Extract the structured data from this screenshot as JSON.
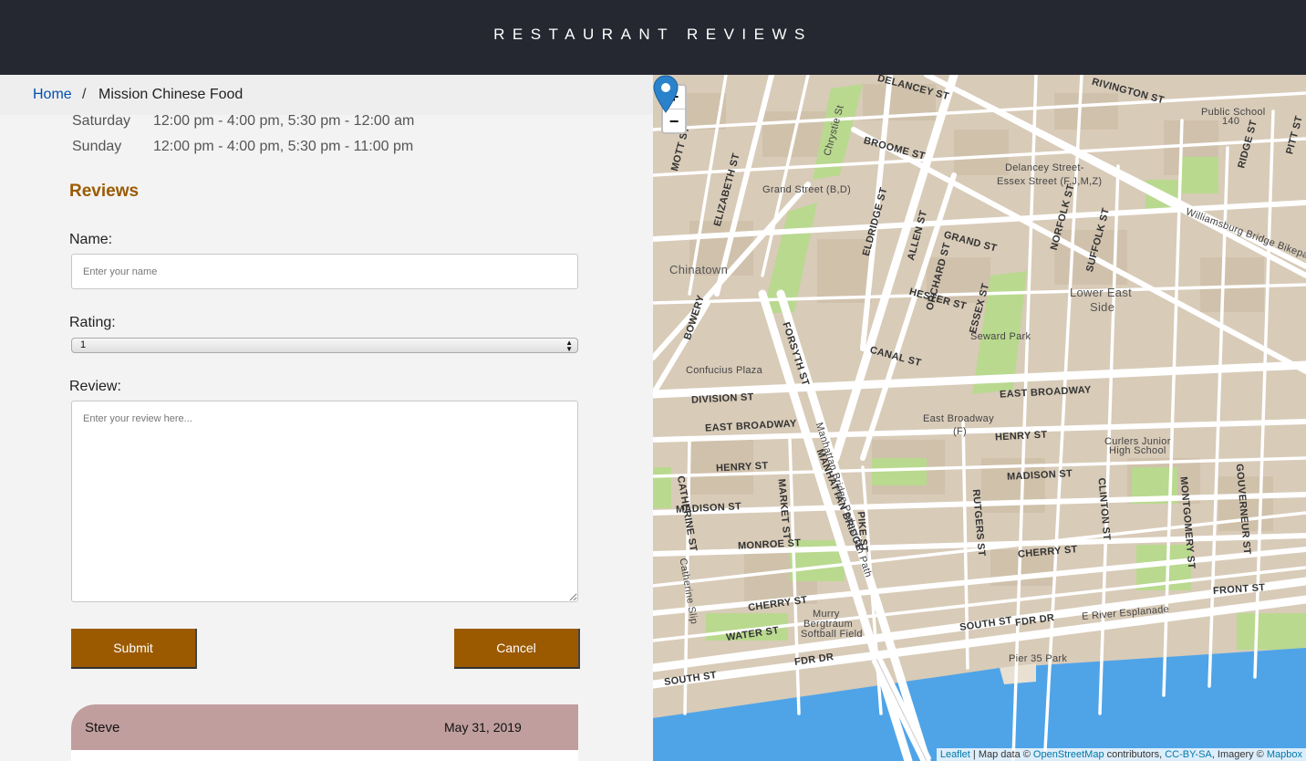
{
  "app": {
    "title": "RESTAURANT REVIEWS"
  },
  "breadcrumb": {
    "home": "Home",
    "separator": "/",
    "current": "Mission Chinese Food"
  },
  "hours": [
    {
      "day": "Saturday",
      "time": "12:00 pm - 4:00 pm, 5:30 pm - 12:00 am"
    },
    {
      "day": "Sunday",
      "time": "12:00 pm - 4:00 pm, 5:30 pm - 11:00 pm"
    }
  ],
  "reviews": {
    "title": "Reviews",
    "form": {
      "name_label": "Name:",
      "name_placeholder": "Enter your name",
      "name_value": "",
      "rating_label": "Rating:",
      "rating_value": "1",
      "review_label": "Review:",
      "review_placeholder": "Enter your review here...",
      "review_value": "",
      "submit_label": "Submit",
      "cancel_label": "Cancel"
    },
    "items": [
      {
        "name": "Steve",
        "date": "May 31, 2019"
      }
    ]
  },
  "map": {
    "zoom_in": "+",
    "zoom_out": "−",
    "labels": [
      "DELANCEY ST",
      "RIVINGTON ST",
      "BROOME ST",
      "Delancey Street-",
      "Essex Street (F,J,M,Z)",
      "Grand Street (B,D)",
      "GRAND ST",
      "Chinatown",
      "Lower East",
      "Side",
      "Seward Park",
      "CANAL ST",
      "Confucius Plaza",
      "DIVISION ST",
      "EAST BROADWAY",
      "East Broadway",
      "(F)",
      "HENRY ST",
      "Curlers Junior",
      "High School",
      "MADISON ST",
      "MONROE ST",
      "CHERRY ST",
      "WATER ST",
      "Murry",
      "Bergtraum",
      "Softball Field",
      "SOUTH ST",
      "FDR DR",
      "FRONT ST",
      "Pier 35 Park",
      "E River Esplanade",
      "Public School",
      "140",
      "BOWERY",
      "FORSYTH ST",
      "MANHATTAN BRIDGE",
      "PIKE ST",
      "RUTGERS ST",
      "CLINTON ST",
      "MONTGOMERY ST",
      "GOUVERNEUR ST",
      "ESSEX ST",
      "ORCHARD ST",
      "ALLEN ST",
      "ELDRIDGE ST",
      "NORFOLK ST",
      "SUFFOLK ST",
      "PITT ST",
      "RIDGE ST",
      "HESTER ST",
      "MOTT ST",
      "ELIZABETH ST",
      "Chrystie St",
      "Williamsburg Bridge Bikepath",
      "CATHERINE ST",
      "MARKET ST",
      "Manhattan Bridge Pedestrian Path",
      "Catherine Slip"
    ],
    "attribution": {
      "leaflet": "Leaflet",
      "text1": " | Map data © ",
      "osm": "OpenStreetMap",
      "text2": " contributors, ",
      "license": "CC-BY-SA",
      "text3": ", Imagery © ",
      "mapbox": "Mapbox"
    },
    "colors": {
      "land": "#d8cbb8",
      "water": "#4fa4e8",
      "park": "#b9d98f",
      "road": "#ffffff",
      "marker": "#2a82cb"
    }
  },
  "colors": {
    "header": "#252831",
    "accent": "#9b5a00",
    "review_header": "#c09e9e",
    "link": "#0050b3"
  }
}
